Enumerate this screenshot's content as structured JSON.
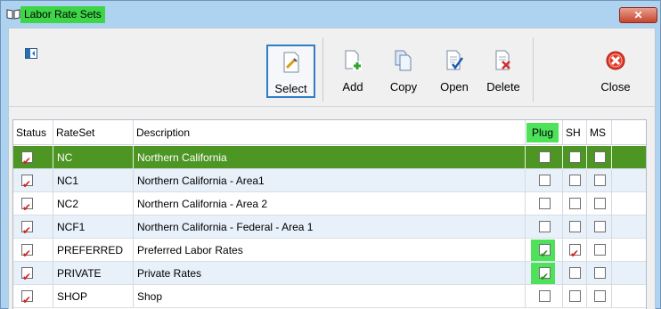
{
  "window": {
    "title": "Labor Rate Sets",
    "close_glyph": "✕"
  },
  "toolbar": {
    "select_label": "Select",
    "add_label": "Add",
    "copy_label": "Copy",
    "open_label": "Open",
    "delete_label": "Delete",
    "close_label": "Close"
  },
  "grid": {
    "columns": {
      "status": "Status",
      "rateset": "RateSet",
      "description": "Description",
      "plug": "Plug",
      "sh": "SH",
      "ms": "MS"
    },
    "rows": [
      {
        "status": true,
        "rateset": "NC",
        "description": "Northern California",
        "plug": false,
        "sh": false,
        "ms": false,
        "current": true
      },
      {
        "status": true,
        "rateset": "NC1",
        "description": "Northern California - Area1",
        "plug": false,
        "sh": false,
        "ms": false
      },
      {
        "status": true,
        "rateset": "NC2",
        "description": "Northern California - Area 2",
        "plug": false,
        "sh": false,
        "ms": false
      },
      {
        "status": true,
        "rateset": "NCF1",
        "description": "Northern California - Federal - Area 1",
        "plug": false,
        "sh": false,
        "ms": false
      },
      {
        "status": true,
        "rateset": "PREFERRED",
        "description": "Preferred Labor Rates",
        "plug": true,
        "sh": true,
        "ms": false
      },
      {
        "status": true,
        "rateset": "PRIVATE",
        "description": "Private Rates",
        "plug": true,
        "sh": false,
        "ms": false
      },
      {
        "status": true,
        "rateset": "SHOP",
        "description": "Shop",
        "plug": false,
        "sh": false,
        "ms": false
      }
    ]
  },
  "colors": {
    "selected_row": "#4d9624",
    "highlight": "#4de25a",
    "alt_row": "#e8f0fa"
  }
}
